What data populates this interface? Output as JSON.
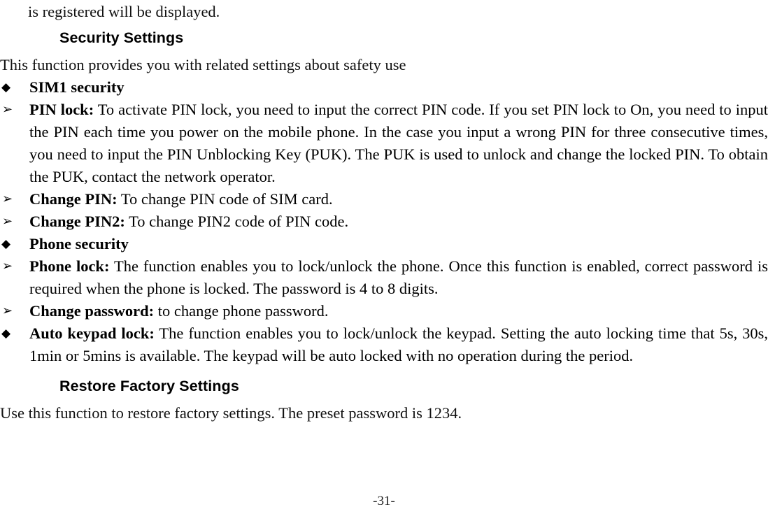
{
  "document": {
    "page_number_label": "-31-"
  },
  "carryover_paragraph": {
    "text": "is registered will be displayed."
  },
  "sections": [
    {
      "heading": "Security Settings",
      "intro": "This function provides you with related settings about safety use",
      "items": [
        {
          "bullet": "diamond",
          "bullet_glyph": "◆",
          "lead": "SIM1 security",
          "rest": ""
        },
        {
          "bullet": "arrow",
          "bullet_glyph": "➢",
          "lead": "PIN lock:",
          "rest": " To activate PIN lock, you need to input the correct PIN code. If you set PIN lock to On, you need to input the PIN each time you power on the mobile phone. In the case you input a wrong PIN for three consecutive times, you need to input the PIN Unblocking Key (PUK). The PUK is used to unlock and change the locked PIN. To obtain the PUK, contact the network operator."
        },
        {
          "bullet": "arrow",
          "bullet_glyph": "➢",
          "lead": "Change PIN:",
          "rest": " To change PIN code of SIM card."
        },
        {
          "bullet": "arrow",
          "bullet_glyph": "➢",
          "lead": "Change PIN2:",
          "rest": " To change PIN2 code of PIN code."
        },
        {
          "bullet": "diamond",
          "bullet_glyph": "◆",
          "lead": "Phone security",
          "rest": ""
        },
        {
          "bullet": "arrow",
          "bullet_glyph": "➢",
          "lead": "Phone lock:",
          "rest": " The function enables you to lock/unlock the phone. Once this function is enabled, correct password is required when the phone is locked. The password is 4 to 8 digits."
        },
        {
          "bullet": "arrow",
          "bullet_glyph": "➢",
          "lead": "Change password:",
          "rest": " to change phone password."
        },
        {
          "bullet": "diamond",
          "bullet_glyph": "◆",
          "lead": "Auto keypad lock:",
          "rest": " The function enables you to lock/unlock the keypad. Setting the auto locking time that 5s, 30s, 1min or 5mins is available. The keypad will be auto locked with no operation during the period."
        }
      ]
    },
    {
      "heading": "Restore Factory Settings",
      "intro": "Use this function to restore factory settings. The preset password is 1234.",
      "items": []
    }
  ]
}
